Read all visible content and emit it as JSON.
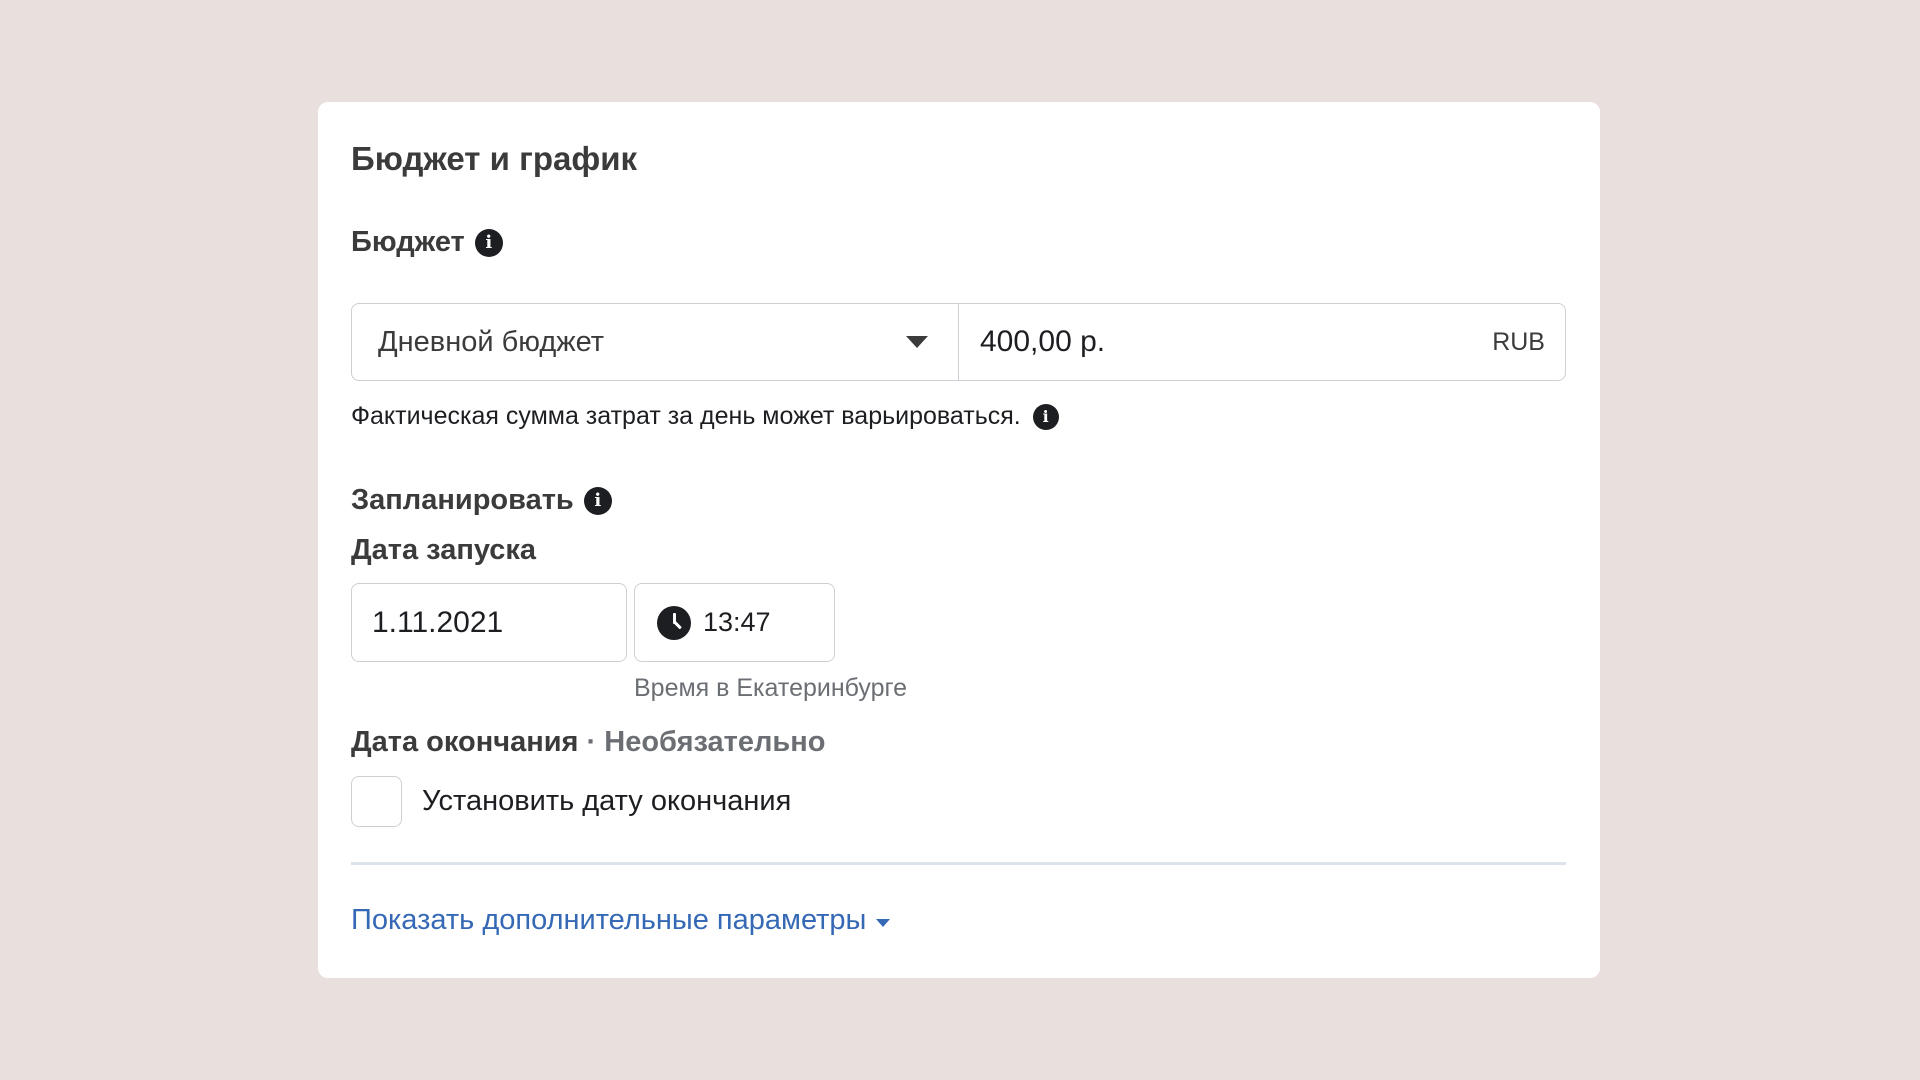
{
  "card": {
    "title": "Бюджет и график"
  },
  "budget": {
    "label": "Бюджет",
    "type_selected": "Дневной бюджет",
    "amount_value": "400,00 р.",
    "currency": "RUB",
    "help_text": "Фактическая сумма затрат за день может варьироваться."
  },
  "schedule": {
    "label": "Запланировать",
    "start_label": "Дата запуска",
    "start_date": "1.11.2021",
    "start_time": "13:47",
    "timezone_note": "Время в Екатеринбурге",
    "end_label": "Дата окончания",
    "end_optional": " · Необязательно",
    "end_checkbox_label": "Установить дату окончания"
  },
  "more": {
    "link_label": "Показать дополнительные параметры"
  },
  "icons": {
    "info": "info-icon",
    "clock": "clock-icon",
    "dropdown": "chevron-down-icon"
  },
  "colors": {
    "background": "#e9dfdd",
    "card": "#ffffff",
    "link": "#3569b5",
    "border": "#ccd0d5"
  }
}
